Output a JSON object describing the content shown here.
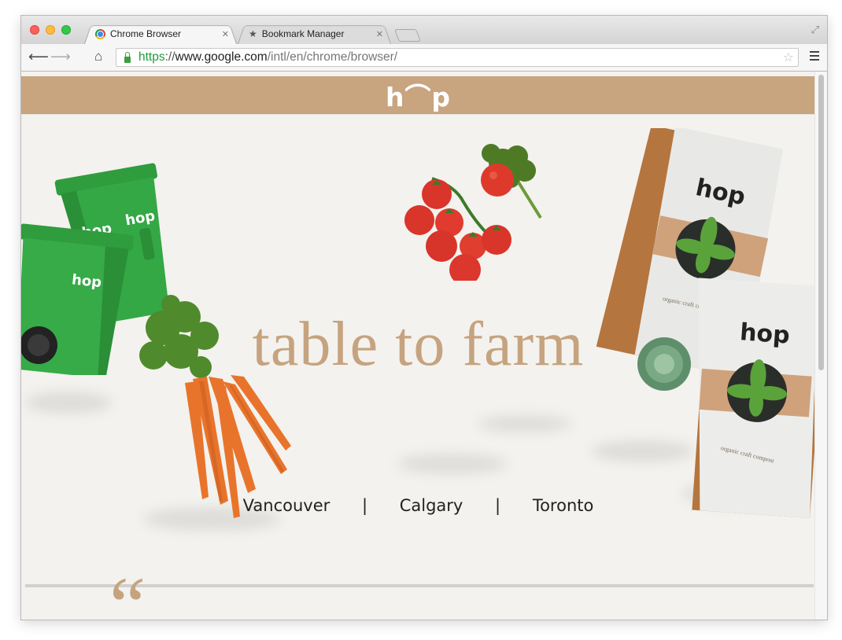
{
  "browser": {
    "tabs": [
      {
        "title": "Chrome Browser",
        "active": true,
        "favicon": "chrome-icon"
      },
      {
        "title": "Bookmark Manager",
        "active": false,
        "favicon": "star-icon"
      }
    ],
    "url": {
      "scheme": "https",
      "separator": "://",
      "host": "www.google.com",
      "path": "/intl/en/chrome/browser/"
    }
  },
  "page": {
    "logo": "h⌒p",
    "hero_title": "table to farm",
    "cities": [
      "Vancouver",
      "Calgary",
      "Toronto"
    ],
    "city_separator": "|",
    "quote_mark": "“",
    "bin_label": "hop",
    "bag_brand": "hop",
    "bag_text": "organic craft compost"
  },
  "colors": {
    "header_tan": "#c8a47f",
    "hero_text": "#c6a37f",
    "bin_green": "#2e9e3e",
    "page_bg": "#f3f2ee"
  }
}
